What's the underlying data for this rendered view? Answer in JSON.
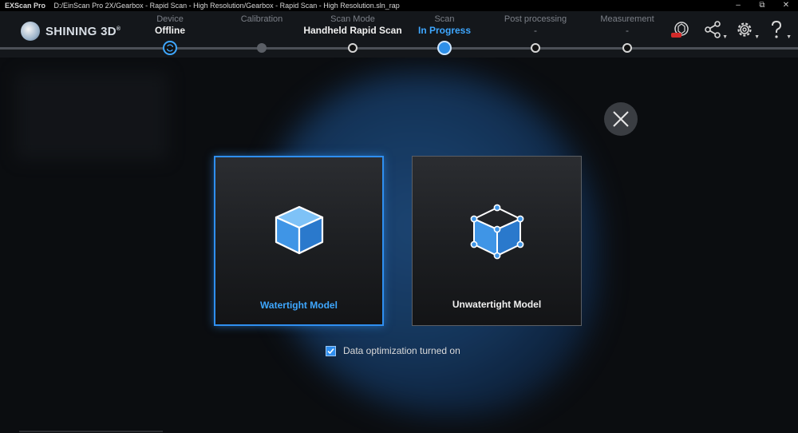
{
  "titlebar": {
    "app_name": "EXScan Pro",
    "path": "D:/EinScan Pro 2X/Gearbox - Rapid Scan - High Resolution/Gearbox - Rapid Scan - High Resolution.sln_rap",
    "minimize": "–",
    "restore": "⧉",
    "close": "✕"
  },
  "header": {
    "brand": "SHINING 3D",
    "brand_mark": "®",
    "steps": [
      {
        "label": "Device",
        "value": "Offline"
      },
      {
        "label": "Calibration",
        "value": ""
      },
      {
        "label": "Scan Mode",
        "value": "Handheld Rapid Scan"
      },
      {
        "label": "Scan",
        "value": "In Progress"
      },
      {
        "label": "Post processing",
        "value": "-"
      },
      {
        "label": "Measurement",
        "value": "-"
      }
    ],
    "icons": [
      "new-badge-icon",
      "share-icon",
      "settings-icon",
      "help-icon"
    ]
  },
  "dialog": {
    "options": [
      {
        "label": "Watertight Model",
        "selected": true,
        "icon": "solid-cube-icon"
      },
      {
        "label": "Unwatertight Model",
        "selected": false,
        "icon": "open-cube-icon"
      }
    ],
    "checkbox": {
      "label": "Data optimization turned on",
      "checked": true
    },
    "close_icon": "close-icon"
  },
  "colors": {
    "accent": "#2f8ff0",
    "accent_text": "#3ea7ff",
    "background": "#0b0d10",
    "header": "#14171b"
  }
}
